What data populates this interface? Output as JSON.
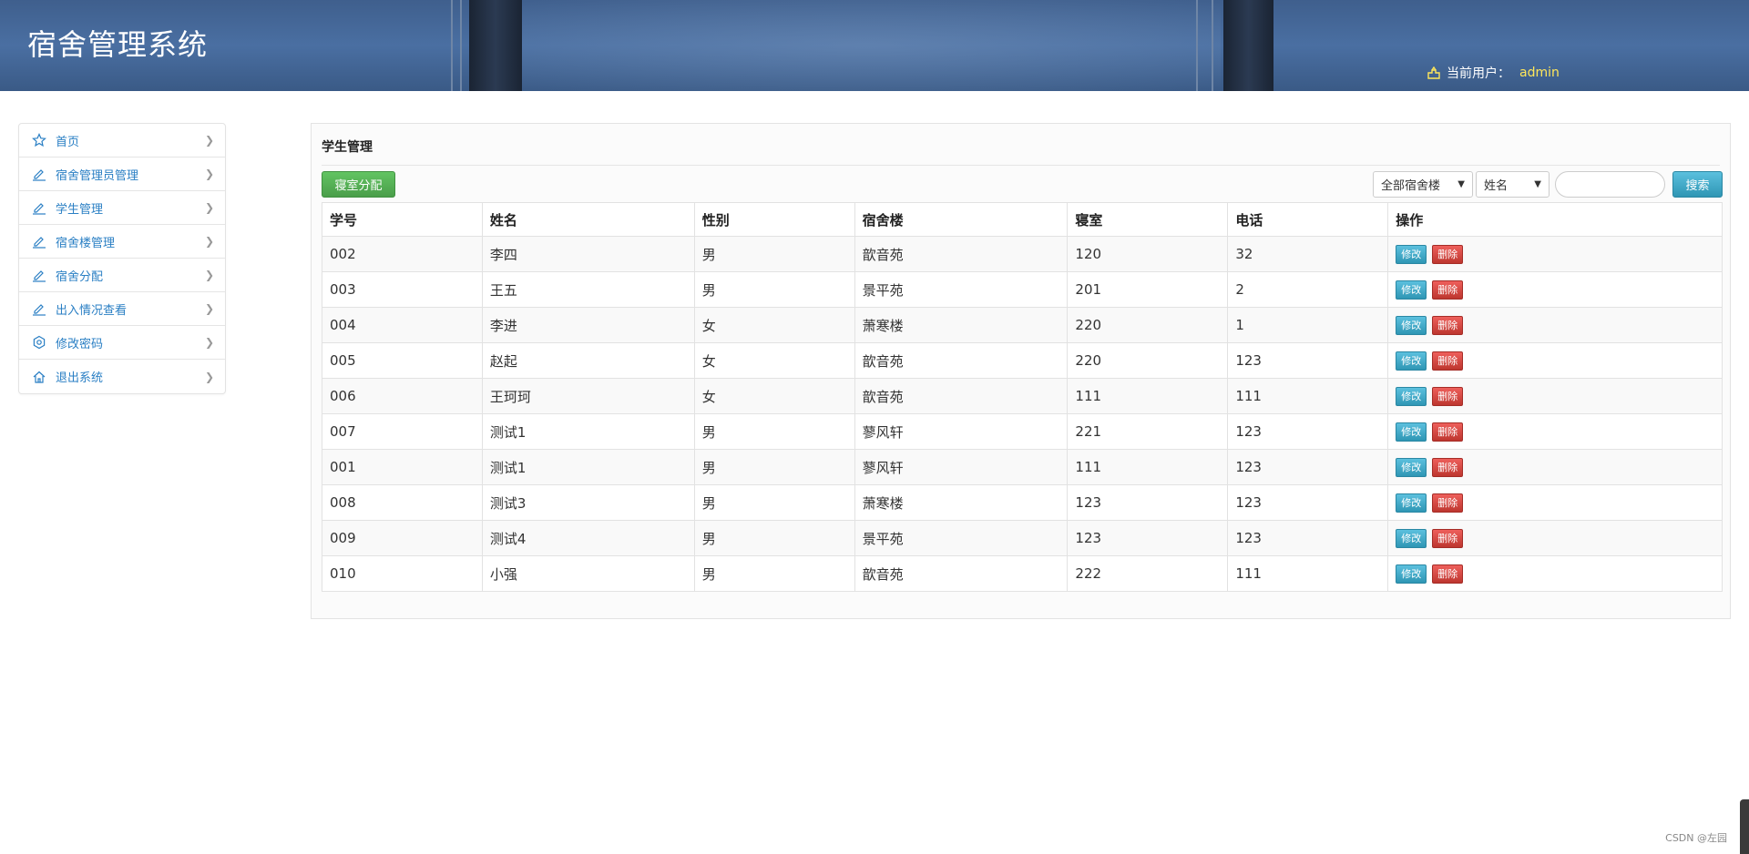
{
  "header": {
    "title": "宿舍管理系统",
    "user_label": "当前用户：",
    "user_name": "admin"
  },
  "sidebar": {
    "items": [
      {
        "label": "首页",
        "icon": "star-icon"
      },
      {
        "label": "宿舍管理员管理",
        "icon": "edit-icon"
      },
      {
        "label": "学生管理",
        "icon": "edit-icon"
      },
      {
        "label": "宿舍楼管理",
        "icon": "edit-icon"
      },
      {
        "label": "宿舍分配",
        "icon": "edit-icon"
      },
      {
        "label": "出入情况查看",
        "icon": "edit-icon"
      },
      {
        "label": "修改密码",
        "icon": "gear-icon"
      },
      {
        "label": "退出系统",
        "icon": "home-icon"
      }
    ]
  },
  "main": {
    "title": "学生管理",
    "assign_button": "寝室分配",
    "building_select": "全部宿舍楼",
    "field_select": "姓名",
    "search_placeholder": "",
    "search_button": "搜索",
    "columns": [
      "学号",
      "姓名",
      "性别",
      "宿舍楼",
      "寝室",
      "电话",
      "操作"
    ],
    "edit_label": "修改",
    "delete_label": "删除",
    "rows": [
      [
        "002",
        "李四",
        "男",
        "歆音苑",
        "120",
        "32"
      ],
      [
        "003",
        "王五",
        "男",
        "景平苑",
        "201",
        "2"
      ],
      [
        "004",
        "李进",
        "女",
        "萧寒楼",
        "220",
        "1"
      ],
      [
        "005",
        "赵起",
        "女",
        "歆音苑",
        "220",
        "123"
      ],
      [
        "006",
        "王珂珂",
        "女",
        "歆音苑",
        "111",
        "111"
      ],
      [
        "007",
        "测试1",
        "男",
        "蓼风轩",
        "221",
        "123"
      ],
      [
        "001",
        "测试1",
        "男",
        "蓼风轩",
        "111",
        "123"
      ],
      [
        "008",
        "测试3",
        "男",
        "萧寒楼",
        "123",
        "123"
      ],
      [
        "009",
        "测试4",
        "男",
        "景平苑",
        "123",
        "123"
      ],
      [
        "010",
        "小强",
        "男",
        "歆音苑",
        "222",
        "111"
      ]
    ]
  },
  "watermark": "CSDN @左园",
  "colors": {
    "link": "#2a7fc4",
    "success": "#4a9e4a",
    "info": "#2f96b4",
    "danger": "#bd362f",
    "user_name": "#ffe75a"
  }
}
